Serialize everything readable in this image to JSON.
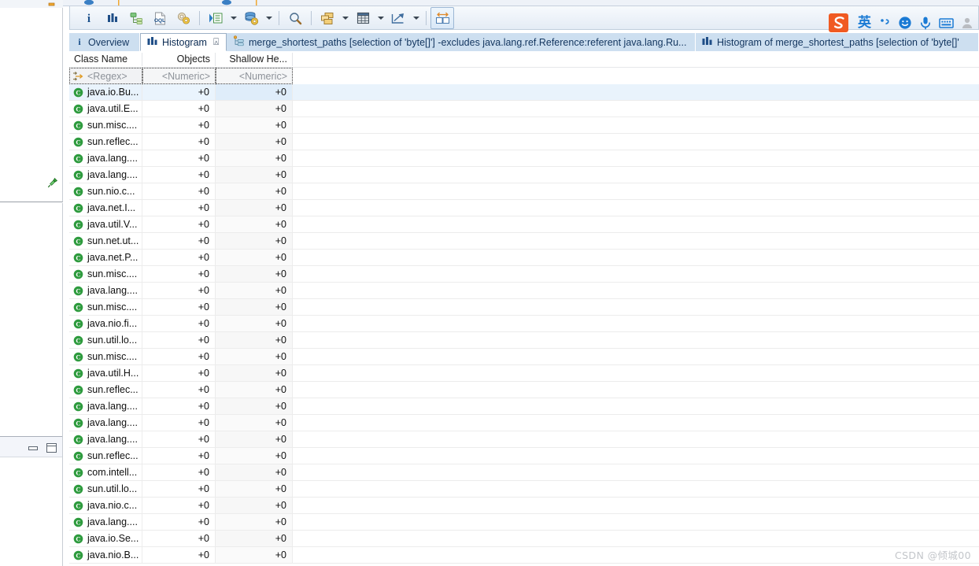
{
  "toolbar": {
    "buttons": [
      {
        "name": "info-icon",
        "title": "Overview information"
      },
      {
        "name": "histogram-icon",
        "title": "Histogram"
      },
      {
        "name": "dominator-tree-icon",
        "title": "Dominator tree"
      },
      {
        "name": "oql-icon",
        "title": "OQL"
      },
      {
        "name": "inspect-settings-icon",
        "title": "Inspect settings"
      },
      {
        "name": "run-query-icon",
        "title": "Run expert system test"
      },
      {
        "name": "database-settings-icon",
        "title": "Query browser"
      },
      {
        "name": "search-icon",
        "title": "Find"
      },
      {
        "name": "group-by-icon",
        "title": "Group result by"
      },
      {
        "name": "calculate-retained-icon",
        "title": "Calculate retained size"
      },
      {
        "name": "export-icon",
        "title": "Export"
      },
      {
        "name": "compare-icon",
        "title": "Compare to another heap dump"
      }
    ]
  },
  "ime": {
    "logo": "sogou-logo-icon",
    "lang_label": "英",
    "items": [
      "ime-punctuation-icon",
      "ime-emoji-icon",
      "ime-voice-icon",
      "ime-keyboard-icon",
      "ime-user-icon"
    ]
  },
  "tabs": [
    {
      "label": "Overview",
      "icon": "info-icon",
      "active": false,
      "closable": false
    },
    {
      "label": "Histogram",
      "icon": "histogram-icon",
      "active": true,
      "closable": true
    },
    {
      "label": "merge_shortest_paths  [selection of 'byte[]'] -excludes java.lang.ref.Reference:referent java.lang.Ru...",
      "icon": "merge-paths-icon",
      "active": false,
      "closable": false
    },
    {
      "label": "Histogram of merge_shortest_paths  [selection of 'byte[]'",
      "icon": "histogram-icon",
      "active": false,
      "closable": false
    }
  ],
  "table": {
    "columns": [
      {
        "label": "Class Name",
        "align": "left",
        "filter": "<Regex>"
      },
      {
        "label": "Objects",
        "align": "right",
        "filter": "<Numeric>"
      },
      {
        "label": "Shallow He...",
        "align": "right",
        "filter": "<Numeric>"
      }
    ],
    "rows": [
      {
        "name": "java.io.Bu...",
        "objects": "+0",
        "shallow": "+0",
        "selected": true
      },
      {
        "name": "java.util.E...",
        "objects": "+0",
        "shallow": "+0"
      },
      {
        "name": "sun.misc....",
        "objects": "+0",
        "shallow": "+0"
      },
      {
        "name": "sun.reflec...",
        "objects": "+0",
        "shallow": "+0"
      },
      {
        "name": "java.lang....",
        "objects": "+0",
        "shallow": "+0"
      },
      {
        "name": "java.lang....",
        "objects": "+0",
        "shallow": "+0"
      },
      {
        "name": "sun.nio.c...",
        "objects": "+0",
        "shallow": "+0"
      },
      {
        "name": "java.net.I...",
        "objects": "+0",
        "shallow": "+0"
      },
      {
        "name": "java.util.V...",
        "objects": "+0",
        "shallow": "+0"
      },
      {
        "name": "sun.net.ut...",
        "objects": "+0",
        "shallow": "+0"
      },
      {
        "name": "java.net.P...",
        "objects": "+0",
        "shallow": "+0"
      },
      {
        "name": "sun.misc....",
        "objects": "+0",
        "shallow": "+0"
      },
      {
        "name": "java.lang....",
        "objects": "+0",
        "shallow": "+0"
      },
      {
        "name": "sun.misc....",
        "objects": "+0",
        "shallow": "+0"
      },
      {
        "name": "java.nio.fi...",
        "objects": "+0",
        "shallow": "+0"
      },
      {
        "name": "sun.util.lo...",
        "objects": "+0",
        "shallow": "+0"
      },
      {
        "name": "sun.misc....",
        "objects": "+0",
        "shallow": "+0"
      },
      {
        "name": "java.util.H...",
        "objects": "+0",
        "shallow": "+0"
      },
      {
        "name": "sun.reflec...",
        "objects": "+0",
        "shallow": "+0"
      },
      {
        "name": "java.lang....",
        "objects": "+0",
        "shallow": "+0"
      },
      {
        "name": "java.lang....",
        "objects": "+0",
        "shallow": "+0"
      },
      {
        "name": "java.lang....",
        "objects": "+0",
        "shallow": "+0"
      },
      {
        "name": "sun.reflec...",
        "objects": "+0",
        "shallow": "+0"
      },
      {
        "name": "com.intell...",
        "objects": "+0",
        "shallow": "+0"
      },
      {
        "name": "sun.util.lo...",
        "objects": "+0",
        "shallow": "+0"
      },
      {
        "name": "java.nio.c...",
        "objects": "+0",
        "shallow": "+0"
      },
      {
        "name": "java.lang....",
        "objects": "+0",
        "shallow": "+0"
      },
      {
        "name": "java.io.Se...",
        "objects": "+0",
        "shallow": "+0"
      },
      {
        "name": "java.nio.B...",
        "objects": "+0",
        "shallow": "+0"
      }
    ]
  },
  "left_panel": {
    "pin": "pin-icon",
    "minimize": "minimize-view-button",
    "maximize": "maximize-view-button"
  },
  "watermark": "CSDN @倾城00",
  "colors": {
    "tab_inactive": "#cddff0",
    "selection": "#e9f3fc",
    "class_icon_green": "#2e9b3e",
    "accent_blue": "#1a5a9e"
  }
}
